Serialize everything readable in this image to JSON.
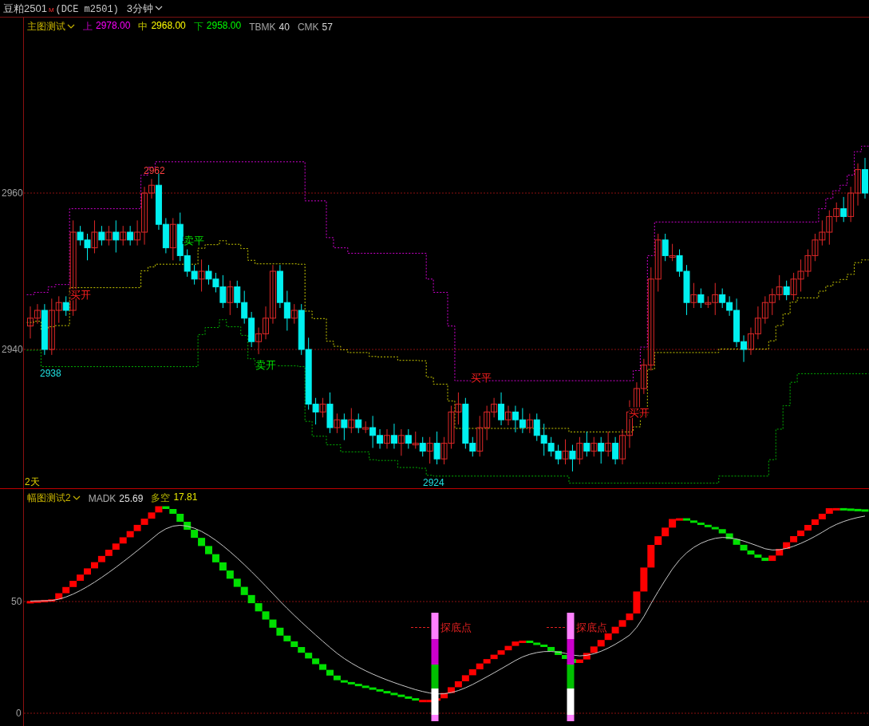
{
  "header": {
    "symbol": "豆粕2501",
    "flag": "M",
    "exchange": "(DCE m2501)",
    "period": "3分钟"
  },
  "main_panel": {
    "indicator": "主图测试",
    "legend": [
      {
        "label": "上",
        "value": "2978.00",
        "color": "#ff00ff"
      },
      {
        "label": "中",
        "value": "2968.00",
        "color": "#ffff00"
      },
      {
        "label": "下",
        "value": "2958.00",
        "color": "#00ff00"
      },
      {
        "label": "TBMK",
        "value": "40",
        "color": "#d8d8d8"
      },
      {
        "label": "CMK",
        "value": "57",
        "color": "#d8d8d8"
      }
    ],
    "axis_labels": [
      "2960",
      "2940"
    ],
    "signals": [
      {
        "text": "买开",
        "kind": "buy"
      },
      {
        "text": "卖平",
        "kind": "sell"
      },
      {
        "text": "卖开",
        "kind": "sell"
      },
      {
        "text": "买平",
        "kind": "buy"
      },
      {
        "text": "买开",
        "kind": "buy"
      }
    ],
    "price_marks": [
      {
        "text": "2962",
        "kind": "high"
      },
      {
        "text": "2938",
        "kind": "low"
      },
      {
        "text": "2924",
        "kind": "low"
      }
    ],
    "period_label": "2天"
  },
  "sub_panel": {
    "indicator": "幅图测试2",
    "legend": [
      {
        "label": "MADK",
        "value": "25.69",
        "color": "#e0e0e0"
      },
      {
        "label": "多空",
        "value": "17.81",
        "color": "#e8e800"
      }
    ],
    "axis_labels": [
      "50",
      "0"
    ],
    "signals": [
      {
        "text": "探底点"
      },
      {
        "text": "探底点"
      }
    ]
  }
}
